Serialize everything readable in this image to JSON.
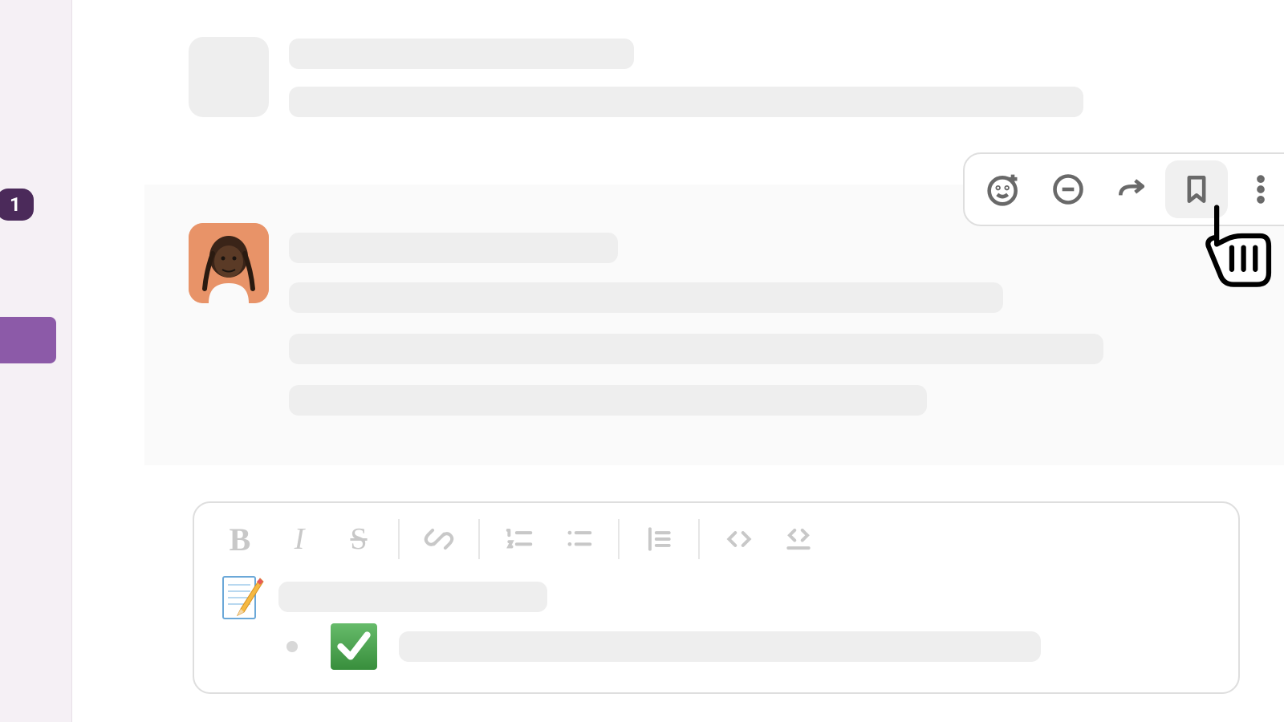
{
  "sidebar": {
    "badge_count": "1"
  },
  "hover_toolbar": {
    "emoji_reaction": "add-reaction",
    "thread": "start-thread",
    "share": "share-message",
    "bookmark": "save-to-later",
    "more": "more-actions"
  },
  "compose_toolbar": {
    "bold": "B",
    "italic": "I",
    "strike": "S",
    "link": "link",
    "ordered_list": "ordered-list",
    "bullet_list": "bullet-list",
    "blockquote": "blockquote",
    "code": "code",
    "code_block": "code-block"
  },
  "compose_content": {
    "memo_emoji": "memo",
    "check_emoji": "white-check-mark"
  }
}
